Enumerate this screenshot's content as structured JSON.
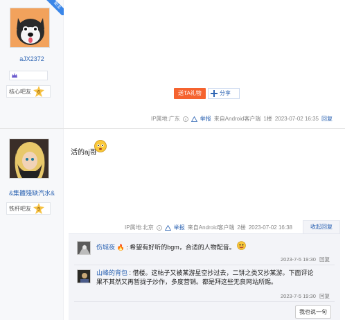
{
  "post1": {
    "user": {
      "badge": "新主",
      "name": "aJX2372",
      "level_label": "核心吧友",
      "level_num": "6"
    },
    "buttons": {
      "gift": "送TA礼物",
      "share": "分享"
    },
    "meta": {
      "ip": "IP属地:广东",
      "report": "举报",
      "source": "来自Android客户端",
      "floor": "1楼",
      "time": "2023-07-02 16:35",
      "reply": "回复"
    }
  },
  "post2": {
    "user": {
      "name": "&集體殘缺汽水&",
      "level_label": "铁杆吧友",
      "level_num": "9"
    },
    "content": "活的aj哥",
    "meta": {
      "ip": "IP属地:北京",
      "report": "举报",
      "source": "来自Android客户端",
      "floor": "2楼",
      "time": "2023-07-02 16:38",
      "reply_tab": "收起回复"
    },
    "replies": [
      {
        "name": "伤城夜",
        "text": ": 希望有好听的bgm，合适的人物配音。",
        "time": "2023-7-5 19:30",
        "reply": "回复"
      },
      {
        "name": "山峰的背包",
        "text_line1": ": 借楼。这帖子又被某游星空抄过去，二饼之类又抄某游。下面评论",
        "text_line2": "果不其然又再暂拢子炒作，多度营销。都是拜这些无良网站所赐。",
        "time": "2023-7-5 19:30",
        "reply": "回复"
      }
    ],
    "say_button": "我也说一句"
  },
  "colors": {
    "link": "#2d64b3",
    "gift": "#f5632f",
    "reply_bg": "#f3f4f8"
  }
}
